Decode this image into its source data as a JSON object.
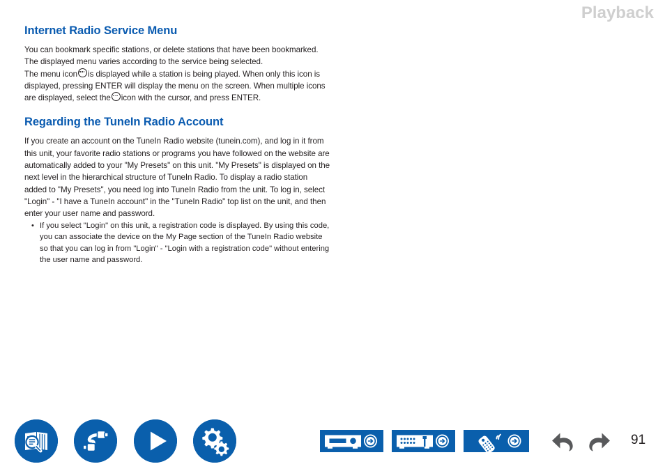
{
  "header": {
    "title": "Playback"
  },
  "content": {
    "section1": {
      "heading": "Internet Radio Service Menu",
      "paragraph1": "You can bookmark specific stations, or delete stations that have been bookmarked. The displayed menu varies according to the service being selected.",
      "paragraph2_part1": "The menu icon",
      "paragraph2_part2": "is displayed while a station is being played. When only this icon is displayed, pressing ENTER will display the menu on the screen. When multiple icons are displayed, select the",
      "paragraph2_part3": "icon with the cursor, and press ENTER."
    },
    "section2": {
      "heading": "Regarding the TuneIn Radio Account",
      "paragraph1": "If you create an account on the TuneIn Radio website (tunein.com), and log in it from this unit, your favorite radio stations or programs you have followed on the website are automatically added to your \"My Presets\" on this unit. \"My Presets\" is displayed on the next level in the hierarchical structure of TuneIn Radio. To display a radio station added to \"My Presets\", you need log into TuneIn Radio from the unit. To log in, select \"Login\" - \"I have a TuneIn account\" in the \"TuneIn Radio\" top list on the unit, and then enter your user name and password.",
      "bullets": [
        "If you select \"Login\" on this unit, a registration code is displayed. By using this code, you can associate the device on the My Page section of the TuneIn Radio website so that you can log in from \"Login\" - \"Login with a registration code\" without entering the user name and password."
      ]
    }
  },
  "bottom_nav": {
    "circle_buttons": [
      {
        "name": "book-search-icon",
        "label": "Contents / Search"
      },
      {
        "name": "cable-connection-icon",
        "label": "Connections"
      },
      {
        "name": "play-icon",
        "label": "Playback"
      },
      {
        "name": "gears-setup-icon",
        "label": "Setup"
      }
    ],
    "panel_buttons": [
      {
        "name": "front-panel-icon",
        "label": "Front Panel"
      },
      {
        "name": "rear-panel-icon",
        "label": "Rear Panel"
      },
      {
        "name": "remote-control-icon",
        "label": "Remote Controller"
      }
    ],
    "nav_arrows": [
      {
        "name": "back-arrow-icon",
        "label": "Back"
      },
      {
        "name": "forward-arrow-icon",
        "label": "Forward"
      }
    ],
    "page_number": "91"
  },
  "colors": {
    "accent_blue": "#0a5fac",
    "heading_blue": "#0a5bb0",
    "header_gray": "#cfcfcf",
    "arrow_gray": "#58595b",
    "text_black": "#231f20"
  }
}
